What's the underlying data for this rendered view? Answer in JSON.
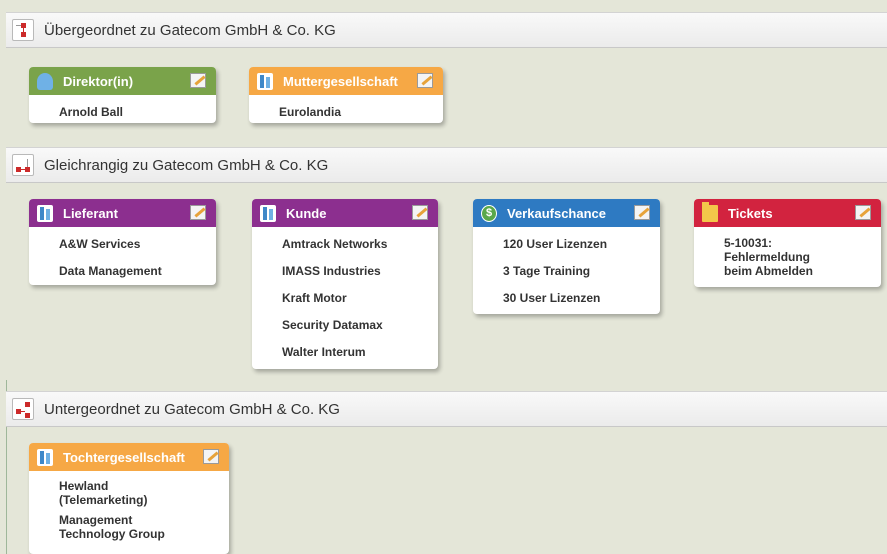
{
  "sections": [
    {
      "title": "Übergeordnet zu Gatecom GmbH & Co. KG"
    },
    {
      "title": "Gleichrangig zu Gatecom GmbH & Co. KG"
    },
    {
      "title": "Untergeordnet zu Gatecom GmbH & Co. KG"
    }
  ],
  "cards": {
    "direktor": {
      "title": "Direktor(in)",
      "color": "#7aa34a",
      "icon": "person-icon",
      "items": [
        "Arnold Ball"
      ]
    },
    "muttergesellschaft": {
      "title": "Muttergesellschaft",
      "color": "#f6a845",
      "icon": "building-icon",
      "items": [
        "Eurolandia"
      ]
    },
    "lieferant": {
      "title": "Lieferant",
      "color": "#8c2f8f",
      "icon": "building-icon",
      "items": [
        "A&W Services",
        "Data Management"
      ]
    },
    "kunde": {
      "title": "Kunde",
      "color": "#8c2f8f",
      "icon": "building-icon",
      "items": [
        "Amtrack Networks",
        "IMASS Industries",
        "Kraft Motor",
        "Security Datamax",
        "Walter Interum"
      ]
    },
    "verkaufschance": {
      "title": "Verkaufschance",
      "color": "#2e7ac2",
      "icon": "dollar-coin-icon",
      "items": [
        "120 User Lizenzen",
        "3 Tage Training",
        "30 User Lizenzen"
      ]
    },
    "tickets": {
      "title": "Tickets",
      "color": "#d2233f",
      "icon": "folder-icon",
      "items": [
        "5-10031: Fehlermeldung beim Abmelden"
      ]
    },
    "tochtergesellschaft": {
      "title": "Tochtergesellschaft",
      "color": "#f6a845",
      "icon": "building-icon",
      "items": [
        "Hewland (Telemarketing)",
        "Management Technology Group"
      ]
    }
  },
  "colors": {
    "background": "#e4e6d8",
    "relation_icon": "#cc2a2a"
  },
  "icons": {
    "section": "relation-tree-icon",
    "edit": "edit-pencil-icon",
    "coin_glyph": "$"
  }
}
